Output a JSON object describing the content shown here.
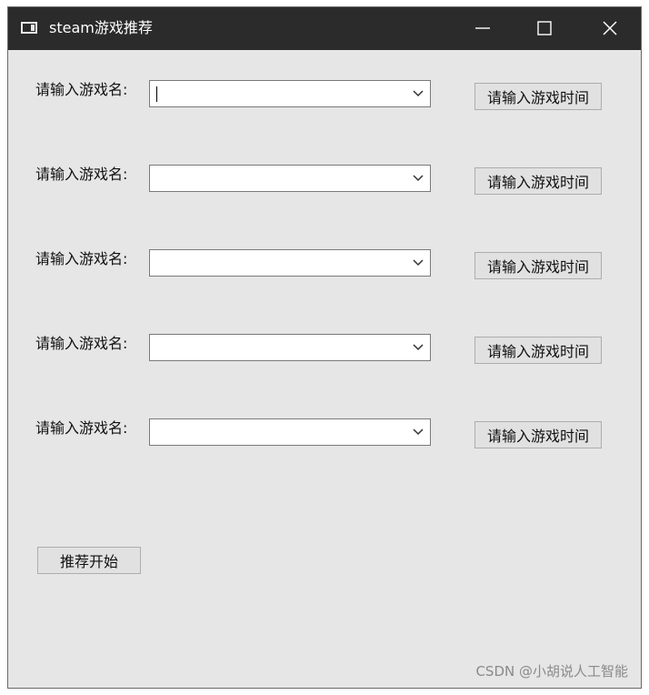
{
  "window": {
    "title": "steam游戏推荐"
  },
  "rows": [
    {
      "label": "请输入游戏名:",
      "value": "",
      "button": "请输入游戏时间"
    },
    {
      "label": "请输入游戏名:",
      "value": "",
      "button": "请输入游戏时间"
    },
    {
      "label": "请输入游戏名:",
      "value": "",
      "button": "请输入游戏时间"
    },
    {
      "label": "请输入游戏名:",
      "value": "",
      "button": "请输入游戏时间"
    },
    {
      "label": "请输入游戏名:",
      "value": "",
      "button": "请输入游戏时间"
    }
  ],
  "start_button": "推荐开始",
  "watermark": "CSDN @小胡说人工智能",
  "icons": {
    "app": "app-window-icon",
    "minimize": "minimize-icon",
    "maximize": "maximize-icon",
    "close": "close-icon",
    "dropdown": "chevron-down-icon"
  },
  "colors": {
    "titlebar": "#2b2b2b",
    "window_bg": "#e6e6e6",
    "button_bg": "#e1e1e1"
  }
}
